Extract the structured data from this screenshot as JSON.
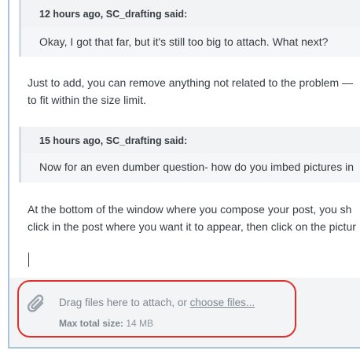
{
  "quotes": [
    {
      "author": "12 hours ago, SC_drafting said:",
      "text": "Okay, I got that far, but it's still too big to attach. What next?"
    },
    {
      "author": "15 hours ago, SC_drafting said:",
      "text": "Now for an even dumber question- how do you imbed pictures in"
    }
  ],
  "paragraphs": {
    "p1_line1": "Just to add, you can remove anything not related to the problem —",
    "p1_line2": "to fit within the size limit.",
    "p2_line1": "At the bottom of the window where you compose your post, you sh",
    "p2_line2": "click in the post where you want it to appear, then click on the pictur"
  },
  "attachments": {
    "drag_prefix": "Drag files here to attach, or ",
    "choose_link": "choose files...",
    "max_label": "Max total size:",
    "max_value": "14 MB",
    "icon": "paperclip-icon"
  },
  "colors": {
    "highlight": "#e0302a",
    "quote_border": "#d5dee6",
    "frame_border": "#a9c4dc"
  }
}
